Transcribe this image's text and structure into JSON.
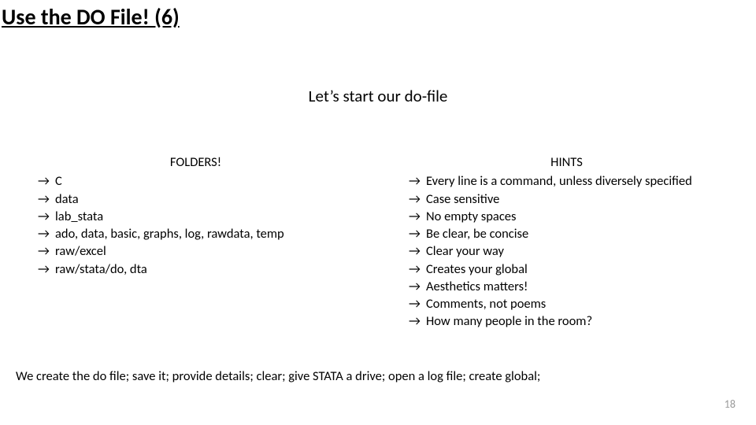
{
  "title": "Use the DO File! (6)",
  "subtitle": "Let’s start our do-file",
  "left": {
    "header": "FOLDERS!",
    "items": [
      "C",
      "data",
      "lab_stata",
      "ado, data, basic, graphs, log, rawdata, temp",
      "raw/excel",
      "raw/stata/do, dta"
    ]
  },
  "right": {
    "header": "HINTS",
    "items": [
      "Every line is a command, unless diversely specified",
      "Case sensitive",
      "No empty spaces",
      "Be clear, be concise",
      "Clear your way",
      "Creates your global",
      "Aesthetics matters!",
      "Comments, not poems",
      "How many people in the room?"
    ]
  },
  "footer": "We create the do file; save it; provide details; clear; give STATA a drive; open a log file; create global;",
  "page_number": "18"
}
